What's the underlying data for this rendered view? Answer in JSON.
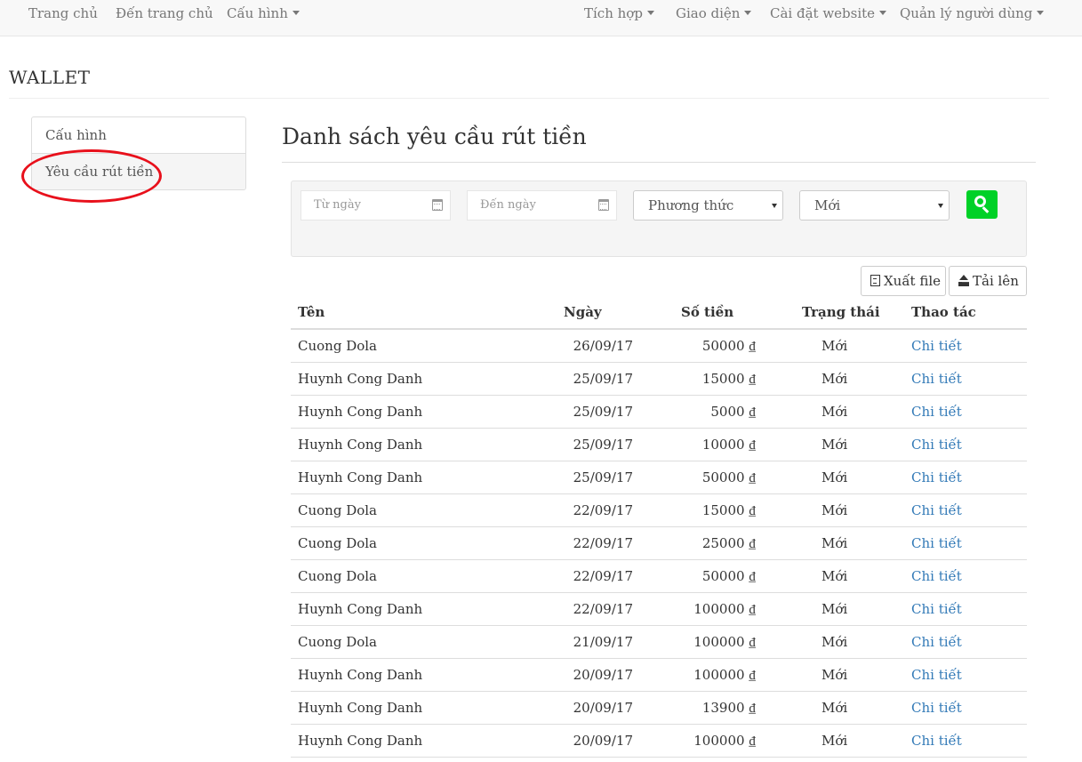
{
  "topnav": {
    "left": [
      {
        "label": "Trang chủ",
        "dropdown": false
      },
      {
        "label": "Đến trang chủ",
        "dropdown": false
      },
      {
        "label": "Cấu hình",
        "dropdown": true
      }
    ],
    "right": [
      {
        "label": "Tích hợp",
        "dropdown": true
      },
      {
        "label": "Giao diện",
        "dropdown": true
      },
      {
        "label": "Cài đặt website",
        "dropdown": true
      },
      {
        "label": "Quản lý người dùng",
        "dropdown": true
      }
    ]
  },
  "app_title": "WALLET",
  "sidebar": {
    "items": [
      {
        "label": "Cấu hình",
        "active": false
      },
      {
        "label": "Yêu cầu rút tiền",
        "active": true
      }
    ],
    "annotation_color": "#e8101b"
  },
  "page_heading": "Danh sách yêu cầu rút tiền",
  "filters": {
    "from_date_placeholder": "Từ ngày",
    "to_date_placeholder": "Đến ngày",
    "method_selected": "Phương thức",
    "status_selected": "Mới",
    "search_button_color": "#00d127"
  },
  "toolbar": {
    "export_label": "Xuất file",
    "upload_label": "Tải lên"
  },
  "table": {
    "columns": [
      "Tên",
      "Ngày",
      "Số tiền",
      "Trạng thái",
      "Thao tác"
    ],
    "rows": [
      {
        "name": "Cuong Dola",
        "date": "26/09/17",
        "amount": "50000 ₫",
        "status": "Mới",
        "action": "Chi tiết"
      },
      {
        "name": "Huynh Cong Danh",
        "date": "25/09/17",
        "amount": "15000 ₫",
        "status": "Mới",
        "action": "Chi tiết"
      },
      {
        "name": "Huynh Cong Danh",
        "date": "25/09/17",
        "amount": "5000 ₫",
        "status": "Mới",
        "action": "Chi tiết"
      },
      {
        "name": "Huynh Cong Danh",
        "date": "25/09/17",
        "amount": "10000 ₫",
        "status": "Mới",
        "action": "Chi tiết"
      },
      {
        "name": "Huynh Cong Danh",
        "date": "25/09/17",
        "amount": "50000 ₫",
        "status": "Mới",
        "action": "Chi tiết"
      },
      {
        "name": "Cuong Dola",
        "date": "22/09/17",
        "amount": "15000 ₫",
        "status": "Mới",
        "action": "Chi tiết"
      },
      {
        "name": "Cuong Dola",
        "date": "22/09/17",
        "amount": "25000 ₫",
        "status": "Mới",
        "action": "Chi tiết"
      },
      {
        "name": "Cuong Dola",
        "date": "22/09/17",
        "amount": "50000 ₫",
        "status": "Mới",
        "action": "Chi tiết"
      },
      {
        "name": "Huynh Cong Danh",
        "date": "22/09/17",
        "amount": "100000 ₫",
        "status": "Mới",
        "action": "Chi tiết"
      },
      {
        "name": "Cuong Dola",
        "date": "21/09/17",
        "amount": "100000 ₫",
        "status": "Mới",
        "action": "Chi tiết"
      },
      {
        "name": "Huynh Cong Danh",
        "date": "20/09/17",
        "amount": "100000 ₫",
        "status": "Mới",
        "action": "Chi tiết"
      },
      {
        "name": "Huynh Cong Danh",
        "date": "20/09/17",
        "amount": "13900 ₫",
        "status": "Mới",
        "action": "Chi tiết"
      },
      {
        "name": "Huynh Cong Danh",
        "date": "20/09/17",
        "amount": "100000 ₫",
        "status": "Mới",
        "action": "Chi tiết"
      }
    ]
  }
}
